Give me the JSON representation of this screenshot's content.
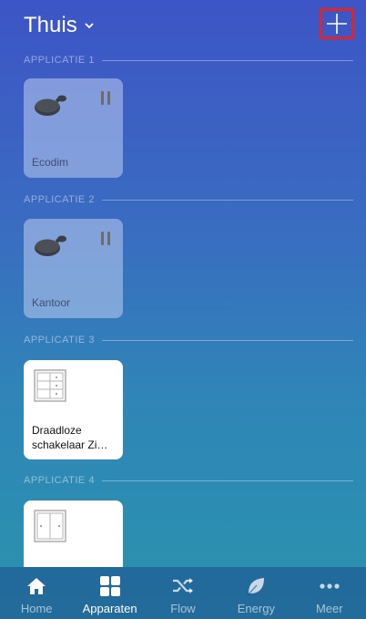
{
  "header": {
    "title": "Thuis"
  },
  "sections": [
    {
      "label": "APPLICATIE 1",
      "device": {
        "name": "Ecodim",
        "state": "paused"
      }
    },
    {
      "label": "APPLICATIE 2",
      "device": {
        "name": "Kantoor",
        "state": "paused"
      }
    },
    {
      "label": "APPLICATIE 3",
      "device": {
        "name": "Draadloze schakelaar Zi…"
      }
    },
    {
      "label": "APPLICATIE 4",
      "device": {
        "name": ""
      }
    }
  ],
  "nav": [
    {
      "label": "Home",
      "icon": "home-icon"
    },
    {
      "label": "Apparaten",
      "icon": "grid-icon",
      "active": true
    },
    {
      "label": "Flow",
      "icon": "shuffle-icon"
    },
    {
      "label": "Energy",
      "icon": "leaf-icon"
    },
    {
      "label": "Meer",
      "icon": "more-dots-icon"
    }
  ],
  "colors": {
    "highlight": "#e0242b",
    "background_top": "#3d55c6",
    "background_bottom": "#2a93ad"
  }
}
